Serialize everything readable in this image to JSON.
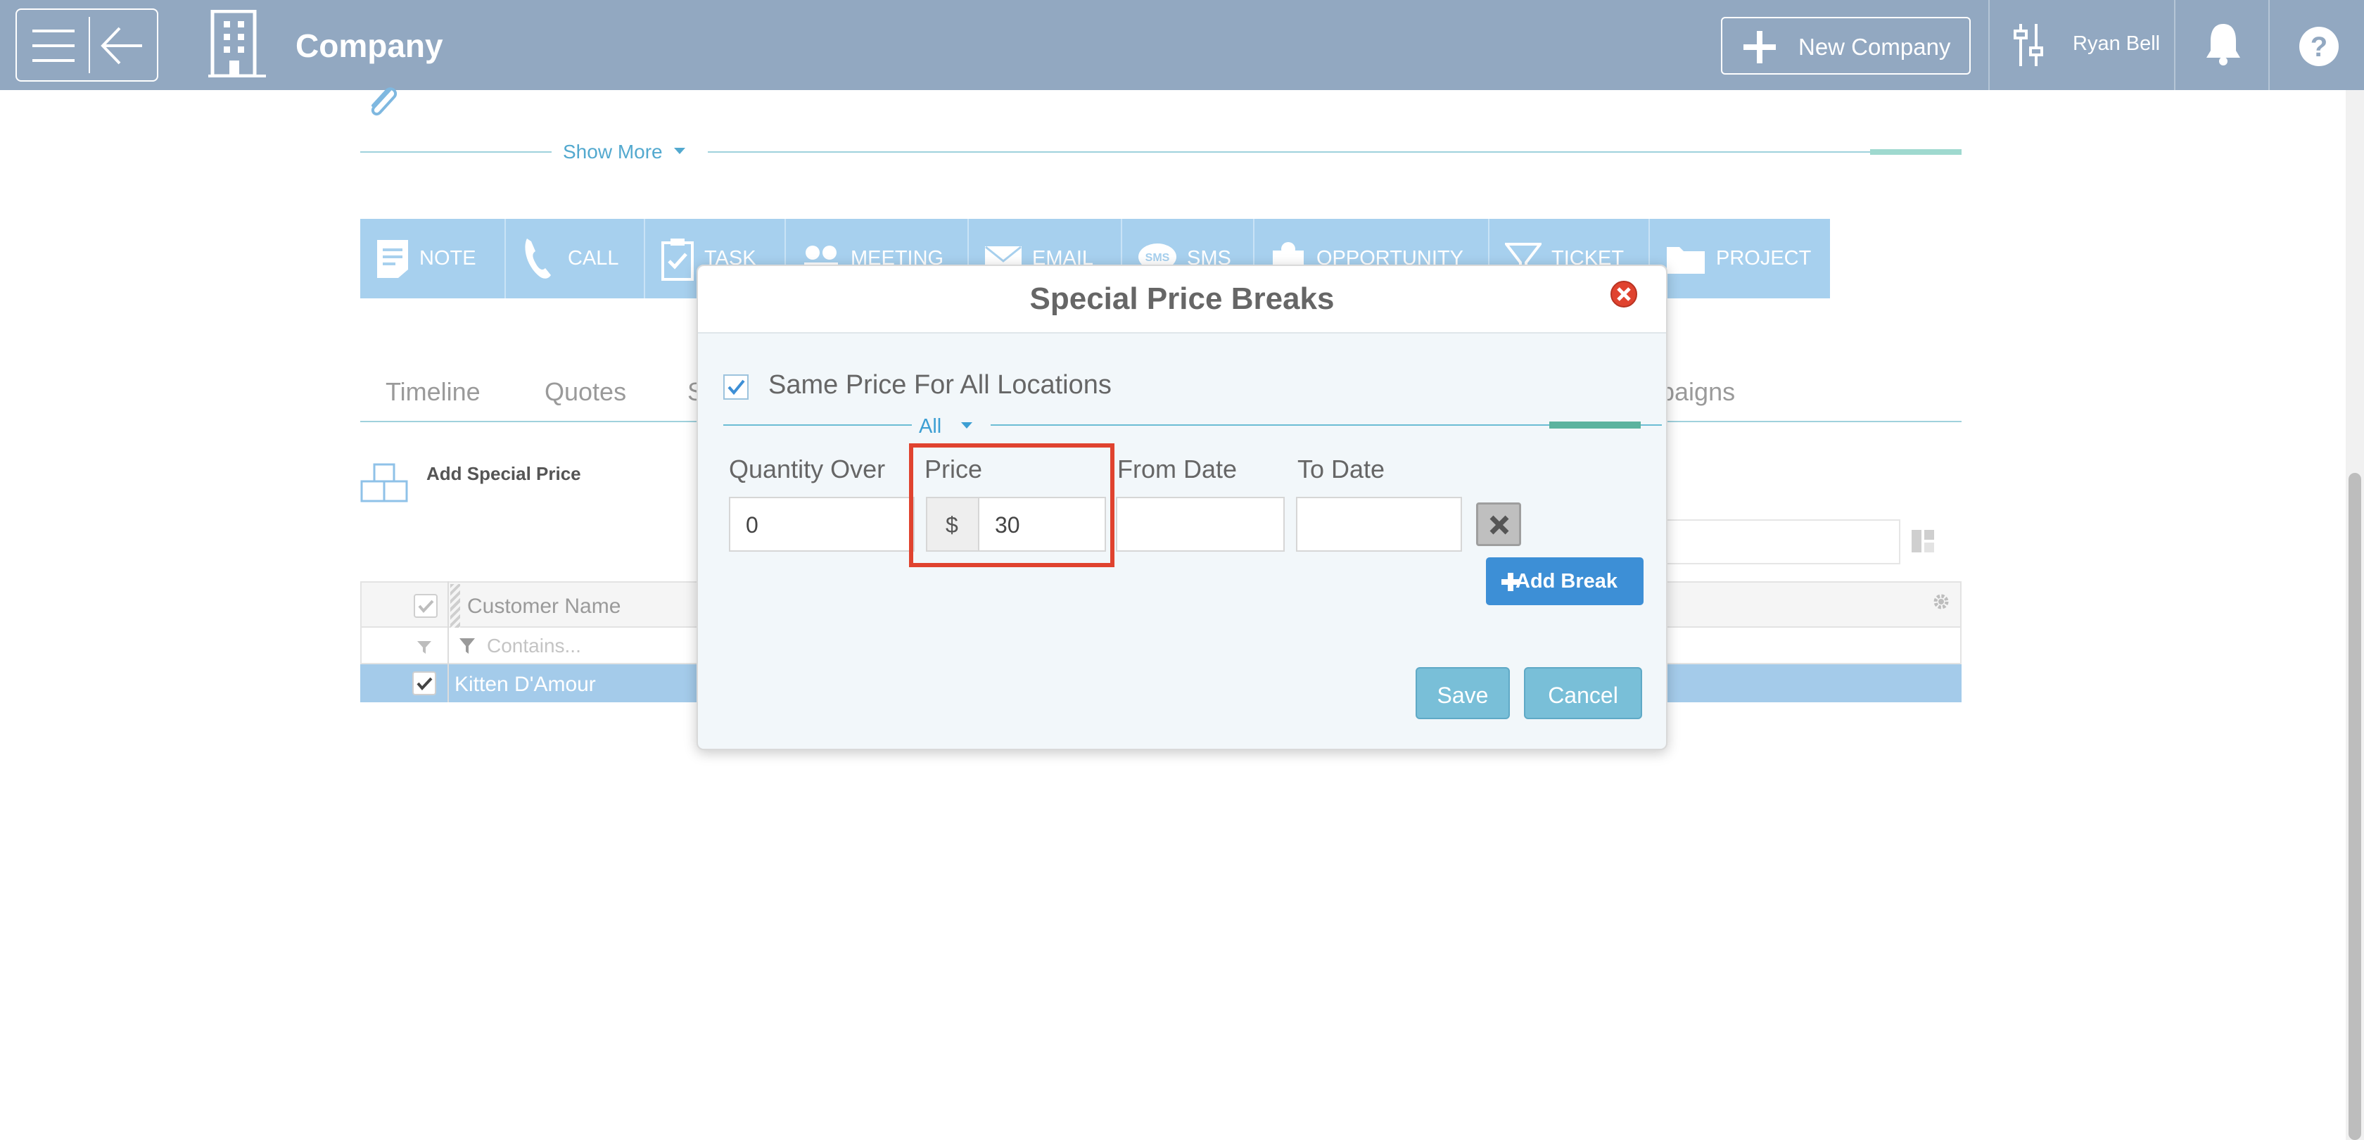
{
  "header": {
    "title": "Company",
    "new_company_label": "New Company",
    "user_name": "Ryan Bell"
  },
  "record": {
    "show_more_label": "Show More"
  },
  "actions": [
    {
      "label": "NOTE",
      "icon": "note-icon"
    },
    {
      "label": "CALL",
      "icon": "phone-icon"
    },
    {
      "label": "TASK",
      "icon": "task-icon"
    },
    {
      "label": "MEETING",
      "icon": "meeting-icon"
    },
    {
      "label": "EMAIL",
      "icon": "email-icon"
    },
    {
      "label": "SMS",
      "icon": "sms-icon"
    },
    {
      "label": "OPPORTUNITY",
      "icon": "opportunity-icon"
    },
    {
      "label": "TICKET",
      "icon": "ticket-icon"
    },
    {
      "label": "PROJECT",
      "icon": "folder-icon"
    }
  ],
  "tabs": {
    "timeline": "Timeline",
    "quotes": "Quotes",
    "partial_left": "S",
    "partial_right": "paigns"
  },
  "special_prices": {
    "add_label": "Add Special Price",
    "search_placeholder": "...",
    "column_header": "Customer Name",
    "filter_placeholder": "Contains...",
    "rows": [
      {
        "customer": "Kitten D'Amour",
        "checked": true
      }
    ]
  },
  "modal": {
    "title": "Special Price Breaks",
    "same_price_label": "Same Price For All Locations",
    "same_price_checked": true,
    "location_tab": "All",
    "columns": {
      "quantity_over": "Quantity Over",
      "price": "Price",
      "from_date": "From Date",
      "to_date": "To Date"
    },
    "break": {
      "quantity_over": "0",
      "currency_symbol": "$",
      "price": "30",
      "from_date": "",
      "to_date": ""
    },
    "add_break_label": "Add Break",
    "save_label": "Save",
    "cancel_label": "Cancel"
  },
  "colors": {
    "topbar": "#92a8c1",
    "action_bar": "#a7d0ee",
    "selected_row": "#a4cbea",
    "primary_button": "#3d8fd6",
    "highlight": "#e0432f"
  }
}
